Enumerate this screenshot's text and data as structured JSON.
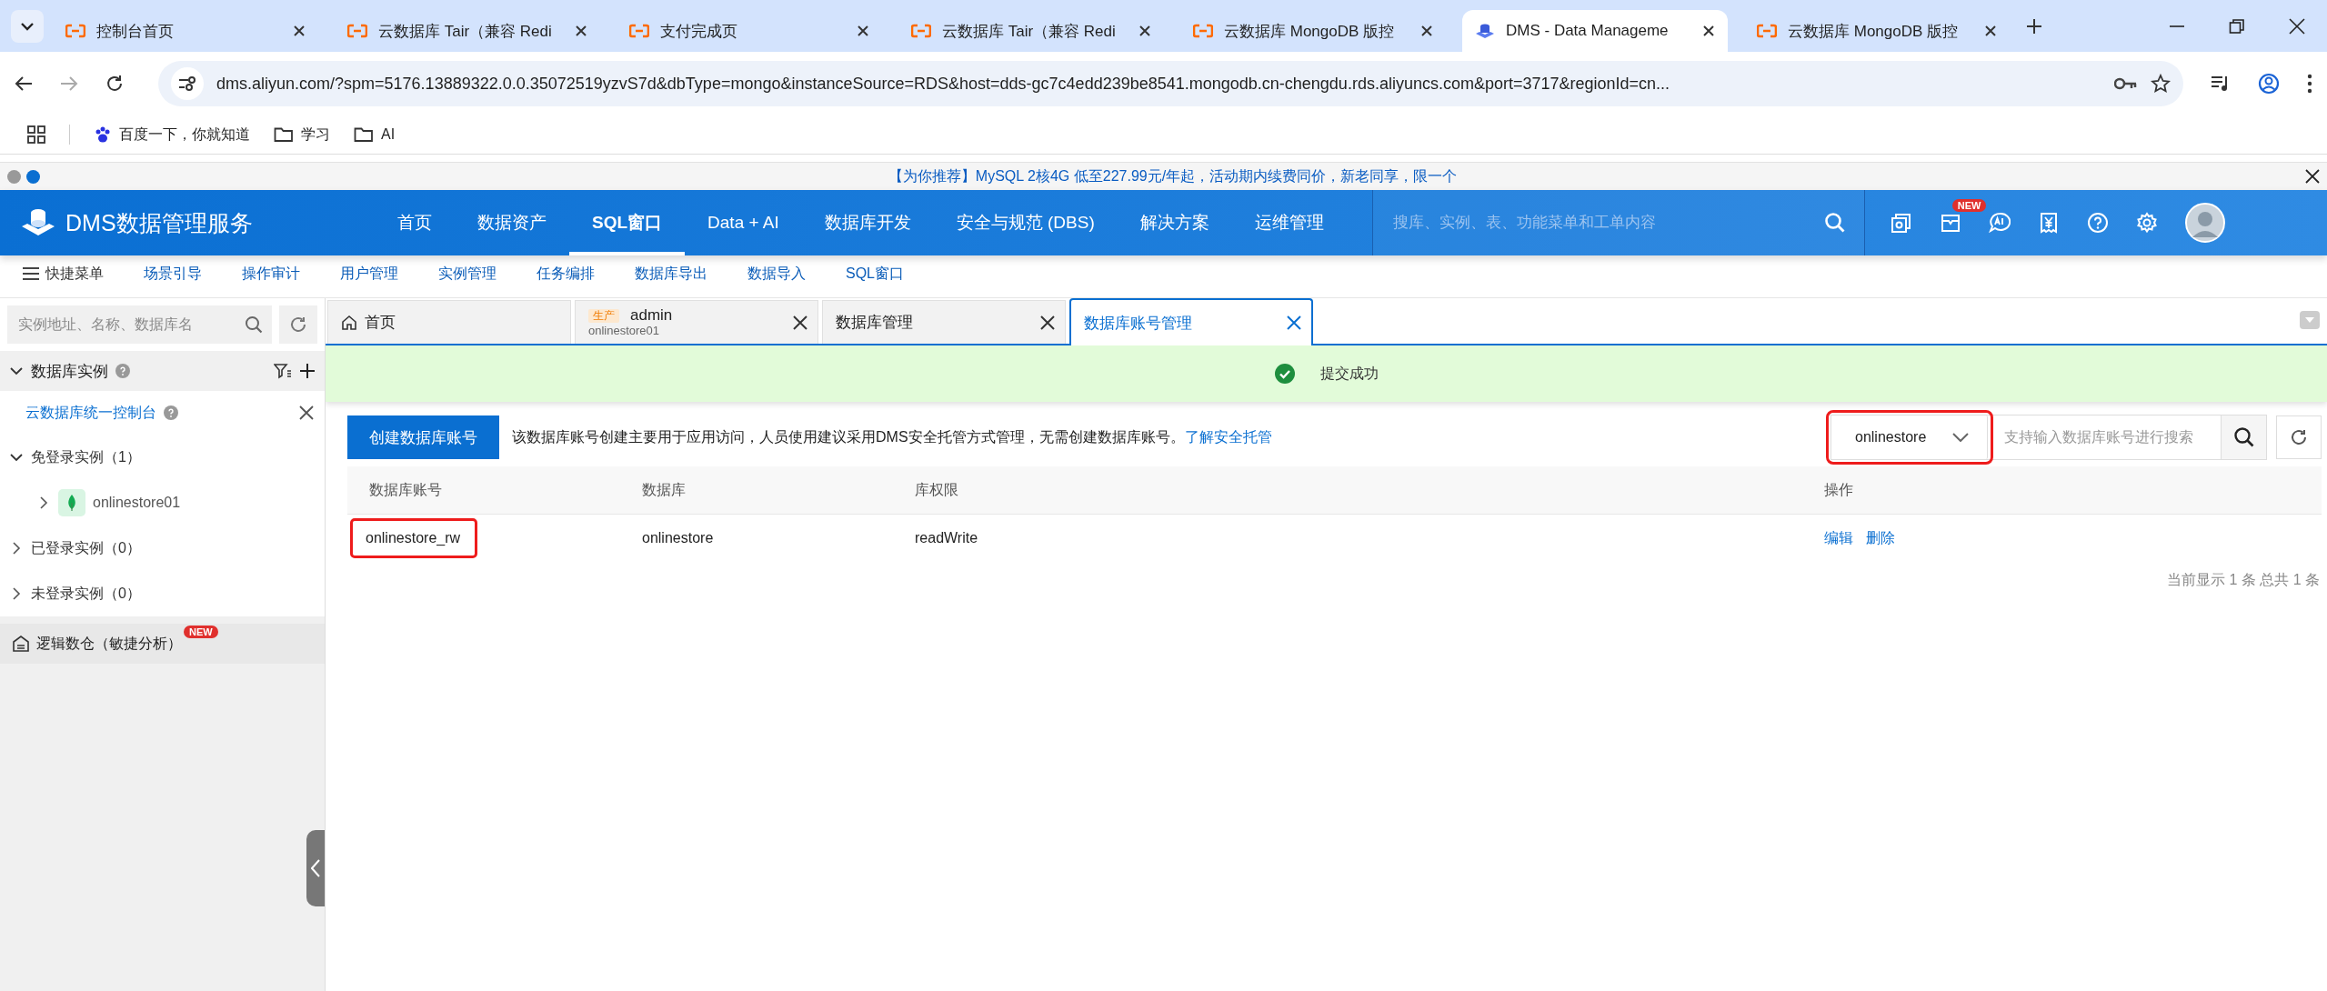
{
  "browser": {
    "tabs": [
      {
        "title": "控制台首页",
        "kind": "aliyun",
        "selected": false
      },
      {
        "title": "云数据库 Tair（兼容 Redi",
        "kind": "aliyun",
        "selected": false
      },
      {
        "title": "支付完成页",
        "kind": "aliyun",
        "selected": false
      },
      {
        "title": "云数据库 Tair（兼容 Redi",
        "kind": "aliyun",
        "selected": false
      },
      {
        "title": "云数据库 MongoDB 版控",
        "kind": "aliyun",
        "selected": false
      },
      {
        "title": "DMS - Data Manageme",
        "kind": "dms",
        "selected": true
      },
      {
        "title": "云数据库 MongoDB 版控",
        "kind": "aliyun",
        "selected": false
      }
    ],
    "url": "dms.aliyun.com/?spm=5176.13889322.0.0.35072519yzvS7d&dbType=mongo&instanceSource=RDS&host=dds-gc7c4edd239be8541.mongodb.cn-chengdu.rds.aliyuncs.com&port=3717&regionId=cn...",
    "bookmarks": [
      {
        "label": "百度一下，你就知道",
        "kind": "paw"
      },
      {
        "label": "学习",
        "kind": "folder"
      },
      {
        "label": "AI",
        "kind": "folder"
      }
    ]
  },
  "promo": {
    "text": "【为你推荐】MySQL 2核4G 低至227.99元/年起，活动期内续费同价，新老同享，限一个"
  },
  "header": {
    "logo": "DMS数据管理服务",
    "nav": [
      {
        "label": "首页",
        "selected": false
      },
      {
        "label": "数据资产",
        "selected": false
      },
      {
        "label": "SQL窗口",
        "selected": true
      },
      {
        "label": "Data + AI",
        "selected": false
      },
      {
        "label": "数据库开发",
        "selected": false
      },
      {
        "label": "安全与规范 (DBS)",
        "selected": false
      },
      {
        "label": "解决方案",
        "selected": false
      },
      {
        "label": "运维管理",
        "selected": false
      }
    ],
    "search": {
      "placeholder": "搜库、实例、表、功能菜单和工单内容"
    },
    "icons": [
      {
        "kind": "instances"
      },
      {
        "kind": "tickets",
        "badge": "NEW"
      },
      {
        "kind": "ai"
      },
      {
        "kind": "billing"
      },
      {
        "kind": "help"
      },
      {
        "kind": "settings"
      },
      {
        "kind": "avatar"
      }
    ]
  },
  "submenu": {
    "menu": "快捷菜单",
    "items": [
      "场景引导",
      "操作审计",
      "用户管理",
      "实例管理",
      "任务编排",
      "数据库导出",
      "数据导入",
      "SQL窗口"
    ]
  },
  "sidebar": {
    "search": {
      "placeholder": "实例地址、名称、数据库名"
    },
    "section": "数据库实例",
    "console_link": "云数据库统一控制台",
    "tree": [
      {
        "label": "免登录实例（1）",
        "expanded": true,
        "children": [
          {
            "label": "onlinestore01",
            "expanded": false
          }
        ]
      },
      {
        "label": "已登录实例（0）",
        "expanded": false
      },
      {
        "label": "未登录实例（0）",
        "expanded": false
      }
    ],
    "warehouse": {
      "label": "逻辑数仓（敏捷分析）",
      "badge": "NEW"
    }
  },
  "work_tabs": [
    {
      "kind": "home",
      "label": "首页",
      "selected": false
    },
    {
      "kind": "instance",
      "env": "生产",
      "label": "admin",
      "sub": "onlinestore01",
      "selected": false
    },
    {
      "kind": "page",
      "label": "数据库管理",
      "selected": false
    },
    {
      "kind": "page",
      "label": "数据库账号管理",
      "selected": true
    }
  ],
  "notice": {
    "text": "提交成功"
  },
  "toolbar": {
    "button": "创建数据库账号",
    "description": "该数据库账号创建主要用于应用访问，人员使用建议采用DMS安全托管方式管理，无需创建数据库账号。",
    "link": "了解安全托管",
    "database_select": {
      "value": "onlinestore",
      "highlighted": true
    },
    "search": {
      "placeholder": "支持输入数据库账号进行搜索"
    }
  },
  "table": {
    "columns": [
      "数据库账号",
      "数据库",
      "库权限",
      "操作"
    ],
    "rows": [
      {
        "account": "onlinestore_rw",
        "highlighted": true,
        "database": "onlinestore",
        "permission": "readWrite",
        "actions": [
          "编辑",
          "删除"
        ]
      }
    ],
    "footer": "当前显示 1 条 总共 1 条"
  }
}
